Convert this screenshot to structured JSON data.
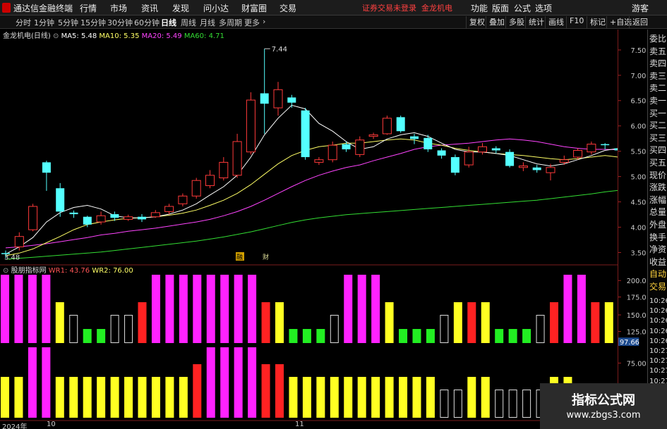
{
  "app": {
    "title": "通达信金融终端",
    "menus": [
      "行情",
      "市场",
      "资讯",
      "发现",
      "问小达",
      "财富圈",
      "交易"
    ],
    "notice": "证券交易未登录",
    "stock_name_top": "金龙机电",
    "right_menus": [
      "功能",
      "版面",
      "公式",
      "选项"
    ],
    "guest": "游客"
  },
  "toolbar": {
    "periods": [
      "分时",
      "1分钟",
      "5分钟",
      "15分钟",
      "30分钟",
      "60分钟",
      "日线",
      "周线",
      "月线",
      "多周期",
      "更多"
    ],
    "active": "日线",
    "right": [
      "复权",
      "叠加",
      "多股",
      "统计",
      "画线",
      "F10",
      "标记",
      "+自选",
      "返回"
    ]
  },
  "legend": {
    "title": "金龙机电(日线)",
    "ma5": "MA5: 5.48",
    "ma10": "MA10: 5.35",
    "ma20": "MA20: 5.49",
    "ma60": "MA60: 4.71",
    "indicator": "股朋指标网",
    "wr1": "WR1: 43.76",
    "wr2": "WR2: 76.00"
  },
  "colors": {
    "up": "#ff3a3a",
    "down": "#54ffff",
    "ma5": "#ffffff",
    "ma10": "#ffff66",
    "ma20": "#ff44ff",
    "ma60": "#33dd33",
    "bar_magenta": "#ff22ff",
    "bar_yellow": "#ffff22",
    "bar_green": "#22ee22",
    "bar_red": "#ff2222"
  },
  "annotations": {
    "high": "7.44",
    "low": "3.48",
    "marker1": "融",
    "marker2": "财"
  },
  "price_axis": [
    "7.50",
    "7.00",
    "6.50",
    "6.00",
    "5.50",
    "5.00",
    "4.50",
    "4.00",
    "3.50"
  ],
  "ind_axis": [
    "200.0",
    "175.0",
    "150.0",
    "125.0",
    "97.66",
    "75.00"
  ],
  "date_labels": [
    "2024年",
    "10",
    "11"
  ],
  "right_panel": {
    "labels": [
      "委比",
      "卖五",
      "卖四",
      "卖三",
      "卖二",
      "卖一",
      "买一",
      "买二",
      "买三",
      "买四",
      "买五",
      "现价",
      "涨跌",
      "涨幅",
      "总量",
      "外盘",
      "换手",
      "净资",
      "收益",
      "自动",
      "交易"
    ],
    "times": [
      "10:26",
      "10:26",
      "10:26",
      "10:26",
      "10:26",
      "10:27",
      "10:27",
      "10:27",
      "10:27",
      "10:27",
      "10:28",
      "10:28",
      "10:28"
    ]
  },
  "watermark": {
    "line1": "指标公式网",
    "line2": "www.zbgs3.com"
  },
  "chart_data": {
    "type": "candlestick",
    "title": "金龙机电(日线)",
    "ylim": [
      3.3,
      7.7
    ],
    "candles": [
      {
        "o": 3.5,
        "c": 3.48,
        "h": 3.55,
        "l": 3.4
      },
      {
        "o": 3.62,
        "c": 3.82,
        "h": 3.9,
        "l": 3.55
      },
      {
        "o": 3.95,
        "c": 4.4,
        "h": 4.45,
        "l": 3.92
      },
      {
        "o": 5.25,
        "c": 5.05,
        "h": 5.28,
        "l": 4.7
      },
      {
        "o": 4.75,
        "c": 4.3,
        "h": 4.85,
        "l": 4.2
      },
      {
        "o": 4.28,
        "c": 4.25,
        "h": 4.32,
        "l": 4.18
      },
      {
        "o": 4.2,
        "c": 4.05,
        "h": 4.22,
        "l": 4.0
      },
      {
        "o": 4.1,
        "c": 4.22,
        "h": 4.3,
        "l": 4.05
      },
      {
        "o": 4.25,
        "c": 4.18,
        "h": 4.3,
        "l": 4.12
      },
      {
        "o": 4.15,
        "c": 4.2,
        "h": 4.24,
        "l": 4.12
      },
      {
        "o": 4.2,
        "c": 4.15,
        "h": 4.25,
        "l": 4.1
      },
      {
        "o": 4.2,
        "c": 4.28,
        "h": 4.33,
        "l": 4.18
      },
      {
        "o": 4.3,
        "c": 4.4,
        "h": 4.45,
        "l": 4.25
      },
      {
        "o": 4.45,
        "c": 4.6,
        "h": 4.65,
        "l": 4.4
      },
      {
        "o": 4.6,
        "c": 4.9,
        "h": 4.95,
        "l": 4.55
      },
      {
        "o": 4.8,
        "c": 5.0,
        "h": 5.1,
        "l": 4.75
      },
      {
        "o": 4.95,
        "c": 5.25,
        "h": 5.35,
        "l": 4.9
      },
      {
        "o": 5.0,
        "c": 5.65,
        "h": 5.8,
        "l": 4.95
      },
      {
        "o": 5.45,
        "c": 6.45,
        "h": 6.6,
        "l": 5.4
      },
      {
        "o": 6.58,
        "c": 6.38,
        "h": 7.44,
        "l": 5.8
      },
      {
        "o": 6.3,
        "c": 6.65,
        "h": 6.8,
        "l": 6.15
      },
      {
        "o": 6.5,
        "c": 6.4,
        "h": 6.55,
        "l": 6.3
      },
      {
        "o": 6.25,
        "c": 5.35,
        "h": 6.3,
        "l": 5.3
      },
      {
        "o": 5.25,
        "c": 5.3,
        "h": 5.35,
        "l": 5.2
      },
      {
        "o": 5.3,
        "c": 5.58,
        "h": 5.65,
        "l": 5.25
      },
      {
        "o": 5.6,
        "c": 5.5,
        "h": 5.65,
        "l": 5.45
      },
      {
        "o": 5.4,
        "c": 5.68,
        "h": 5.75,
        "l": 5.35
      },
      {
        "o": 5.75,
        "c": 5.78,
        "h": 5.82,
        "l": 5.7
      },
      {
        "o": 5.8,
        "c": 6.1,
        "h": 6.15,
        "l": 5.78
      },
      {
        "o": 6.12,
        "c": 5.85,
        "h": 6.15,
        "l": 5.82
      },
      {
        "o": 5.75,
        "c": 5.7,
        "h": 5.8,
        "l": 5.6
      },
      {
        "o": 5.72,
        "c": 5.5,
        "h": 5.78,
        "l": 5.45
      },
      {
        "o": 5.48,
        "c": 5.38,
        "h": 5.52,
        "l": 5.32
      },
      {
        "o": 5.35,
        "c": 5.05,
        "h": 5.4,
        "l": 5.0
      },
      {
        "o": 5.2,
        "c": 5.45,
        "h": 5.55,
        "l": 5.15
      },
      {
        "o": 5.45,
        "c": 5.55,
        "h": 5.62,
        "l": 5.4
      },
      {
        "o": 5.52,
        "c": 5.48,
        "h": 5.56,
        "l": 5.42
      },
      {
        "o": 5.45,
        "c": 5.18,
        "h": 5.5,
        "l": 5.15
      },
      {
        "o": 5.15,
        "c": 5.18,
        "h": 5.25,
        "l": 5.08
      },
      {
        "o": 5.15,
        "c": 5.1,
        "h": 5.2,
        "l": 5.05
      },
      {
        "o": 5.05,
        "c": 5.15,
        "h": 5.22,
        "l": 4.9
      },
      {
        "o": 5.25,
        "c": 5.3,
        "h": 5.38,
        "l": 5.2
      },
      {
        "o": 5.35,
        "c": 5.48,
        "h": 5.52,
        "l": 5.3
      },
      {
        "o": 5.45,
        "c": 5.6,
        "h": 5.65,
        "l": 5.4
      },
      {
        "o": 5.6,
        "c": 5.58,
        "h": 5.62,
        "l": 5.5
      },
      {
        "o": 5.52,
        "c": 5.48,
        "h": 5.62,
        "l": 5.42
      }
    ],
    "ma5": [
      3.48,
      3.62,
      3.8,
      4.1,
      4.28,
      4.38,
      4.42,
      4.35,
      4.22,
      4.18,
      4.18,
      4.2,
      4.25,
      4.33,
      4.45,
      4.62,
      4.78,
      5.0,
      5.35,
      5.78,
      6.1,
      6.35,
      6.28,
      6.0,
      5.85,
      5.65,
      5.5,
      5.55,
      5.7,
      5.78,
      5.82,
      5.75,
      5.62,
      5.5,
      5.45,
      5.45,
      5.42,
      5.38,
      5.3,
      5.22,
      5.18,
      5.22,
      5.3,
      5.38,
      5.48,
      5.52
    ],
    "ma10": [
      3.45,
      3.5,
      3.58,
      3.7,
      3.82,
      3.95,
      4.05,
      4.1,
      4.14,
      4.17,
      4.18,
      4.2,
      4.23,
      4.27,
      4.33,
      4.42,
      4.52,
      4.65,
      4.82,
      5.02,
      5.22,
      5.38,
      5.48,
      5.55,
      5.58,
      5.62,
      5.62,
      5.65,
      5.68,
      5.7,
      5.68,
      5.62,
      5.58,
      5.52,
      5.48,
      5.45,
      5.42,
      5.4,
      5.38,
      5.35,
      5.32,
      5.3,
      5.32,
      5.35,
      5.38,
      5.35
    ],
    "ma20": [
      3.6,
      3.62,
      3.65,
      3.68,
      3.72,
      3.76,
      3.8,
      3.85,
      3.88,
      3.92,
      3.95,
      3.98,
      4.02,
      4.06,
      4.1,
      4.15,
      4.22,
      4.3,
      4.4,
      4.52,
      4.65,
      4.78,
      4.9,
      5.0,
      5.08,
      5.15,
      5.2,
      5.28,
      5.35,
      5.42,
      5.5,
      5.55,
      5.58,
      5.6,
      5.62,
      5.65,
      5.68,
      5.7,
      5.68,
      5.65,
      5.6,
      5.55,
      5.52,
      5.5,
      5.5,
      5.49
    ],
    "ma60": [
      3.38,
      3.4,
      3.42,
      3.44,
      3.46,
      3.48,
      3.5,
      3.52,
      3.55,
      3.58,
      3.61,
      3.64,
      3.67,
      3.7,
      3.73,
      3.77,
      3.81,
      3.86,
      3.91,
      3.97,
      4.03,
      4.09,
      4.14,
      4.18,
      4.21,
      4.24,
      4.26,
      4.28,
      4.3,
      4.32,
      4.34,
      4.36,
      4.38,
      4.4,
      4.42,
      4.44,
      4.46,
      4.48,
      4.5,
      4.52,
      4.55,
      4.58,
      4.61,
      4.64,
      4.68,
      4.71
    ],
    "wr_top": [
      "m",
      "m",
      "m",
      "m",
      "y",
      "e",
      "g",
      "g",
      "e",
      "e",
      "r",
      "m",
      "m",
      "m",
      "m",
      "m",
      "m",
      "m",
      "m",
      "r",
      "y",
      "g",
      "g",
      "g",
      "e",
      "m",
      "m",
      "m",
      "y",
      "g",
      "g",
      "g",
      "e",
      "y",
      "r",
      "y",
      "g",
      "g",
      "g",
      "e",
      "r",
      "m",
      "m",
      "r",
      "y"
    ],
    "wr_bottom": [
      "y",
      "y",
      "m",
      "m",
      "y",
      "y",
      "y",
      "y",
      "y",
      "y",
      "y",
      "y",
      "y",
      "y",
      "r",
      "m",
      "m",
      "m",
      "m",
      "r",
      "r",
      "y",
      "y",
      "y",
      "y",
      "y",
      "y",
      "y",
      "y",
      "y",
      "y",
      "y",
      "e",
      "e",
      "y",
      "y",
      "e",
      "e",
      "e",
      "e",
      "y",
      "y",
      "e",
      "e",
      "e"
    ]
  }
}
